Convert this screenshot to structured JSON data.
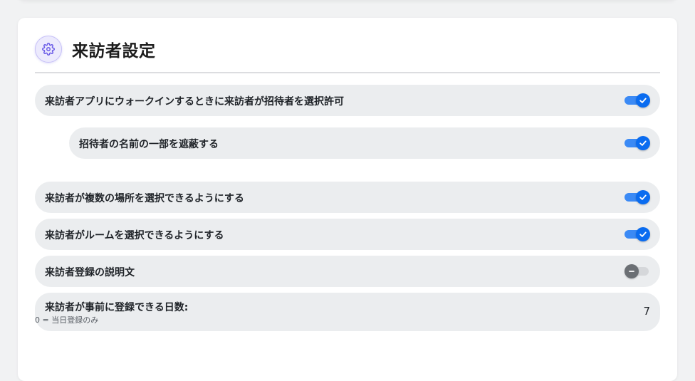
{
  "section": {
    "title": "来訪者設定",
    "icon": "gear-icon",
    "accent_color": "#6b5ce7"
  },
  "settings": {
    "allow_select_host": {
      "label": "来訪者アプリにウォークインするときに来訪者が招待者を選択許可",
      "enabled": true
    },
    "mask_host_name": {
      "label": "招待者の名前の一部を遮蔽する",
      "enabled": true
    },
    "select_multiple_locations": {
      "label": "来訪者が複数の場所を選択できるようにする",
      "enabled": true
    },
    "select_room": {
      "label": "来訪者がルームを選択できるようにする",
      "enabled": true
    },
    "registration_description": {
      "label": "来訪者登録の説明文",
      "enabled": false
    },
    "advance_registration_days": {
      "label": "来訪者が事前に登録できる日数:",
      "hint": "0 = 当日登録のみ",
      "value": "7"
    }
  },
  "colors": {
    "toggle_on": "#0a6cf0",
    "toggle_off": "#6b6f74",
    "row_background": "#ebedef"
  }
}
